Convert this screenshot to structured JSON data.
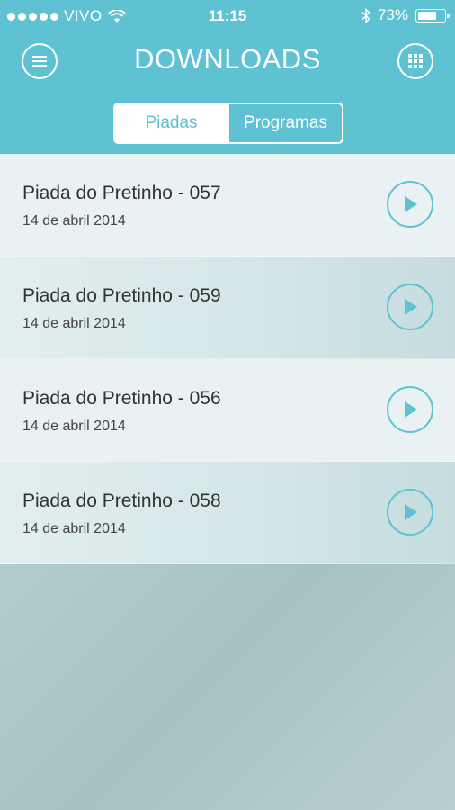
{
  "status_bar": {
    "carrier": "VIVO",
    "time": "11:15",
    "battery_text": "73%",
    "battery_level": 0.73
  },
  "header": {
    "title": "DOWNLOADS",
    "tabs": [
      {
        "label": "Piadas",
        "active": true
      },
      {
        "label": "Programas",
        "active": false
      }
    ]
  },
  "downloads": [
    {
      "title": "Piada do Pretinho - 057",
      "date": "14 de abril 2014"
    },
    {
      "title": "Piada do Pretinho - 059",
      "date": "14 de abril 2014"
    },
    {
      "title": "Piada do Pretinho - 056",
      "date": "14 de abril 2014"
    },
    {
      "title": "Piada do Pretinho - 058",
      "date": "14 de abril 2014"
    }
  ],
  "icons": {
    "menu": "menu-icon",
    "grid": "grid-icon",
    "play": "play-icon",
    "wifi": "wifi-icon",
    "bluetooth": "bluetooth-icon",
    "battery": "battery-icon"
  },
  "colors": {
    "accent": "#5ec2d2",
    "header_bg": "#5ec2d2",
    "row_text": "#333333"
  }
}
